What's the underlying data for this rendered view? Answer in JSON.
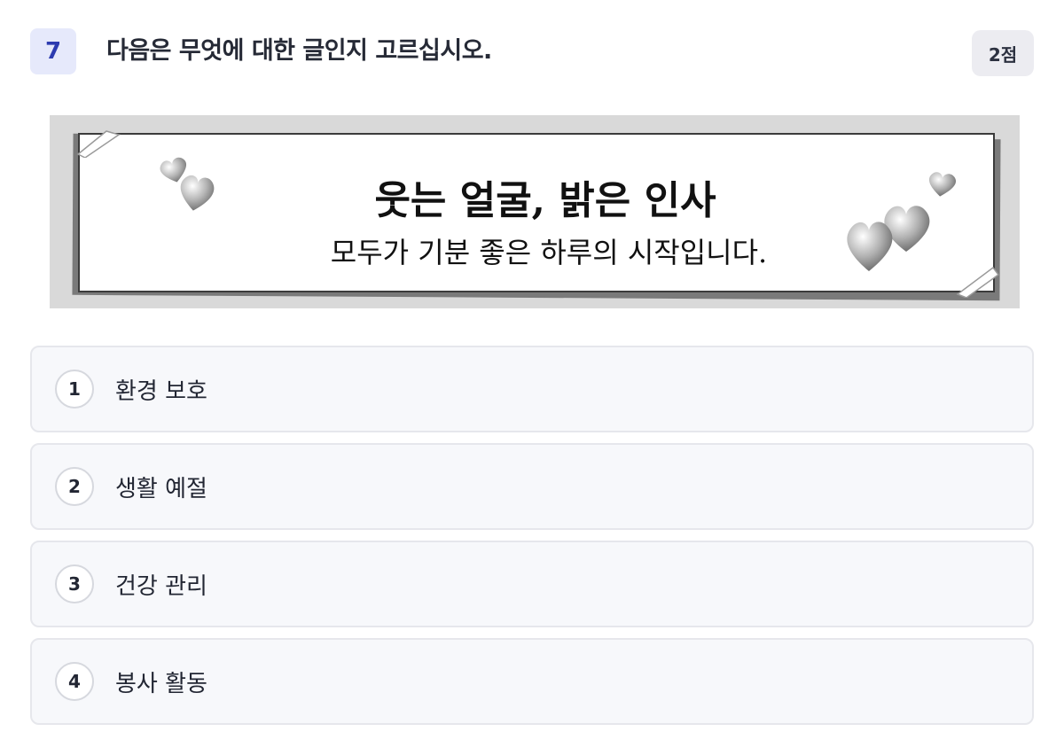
{
  "question": {
    "number": "7",
    "prompt": "다음은 무엇에 대한 글인지 고르십시오.",
    "points": "2점"
  },
  "banner": {
    "title": "웃는 얼굴, 밝은 인사",
    "subtitle": "모두가 기분 좋은 하루의 시작입니다.",
    "decoration_icon": "heart-icon"
  },
  "options": [
    {
      "number": "1",
      "text": "환경 보호"
    },
    {
      "number": "2",
      "text": "생활 예절"
    },
    {
      "number": "3",
      "text": "건강 관리"
    },
    {
      "number": "4",
      "text": "봉사 활동"
    }
  ],
  "colors": {
    "accent": "#2d3bb0",
    "number_badge_bg": "#e6e9fb",
    "points_badge_bg": "#ececf1",
    "option_bg": "#f7f8fb",
    "option_border": "#e6e7ec"
  }
}
